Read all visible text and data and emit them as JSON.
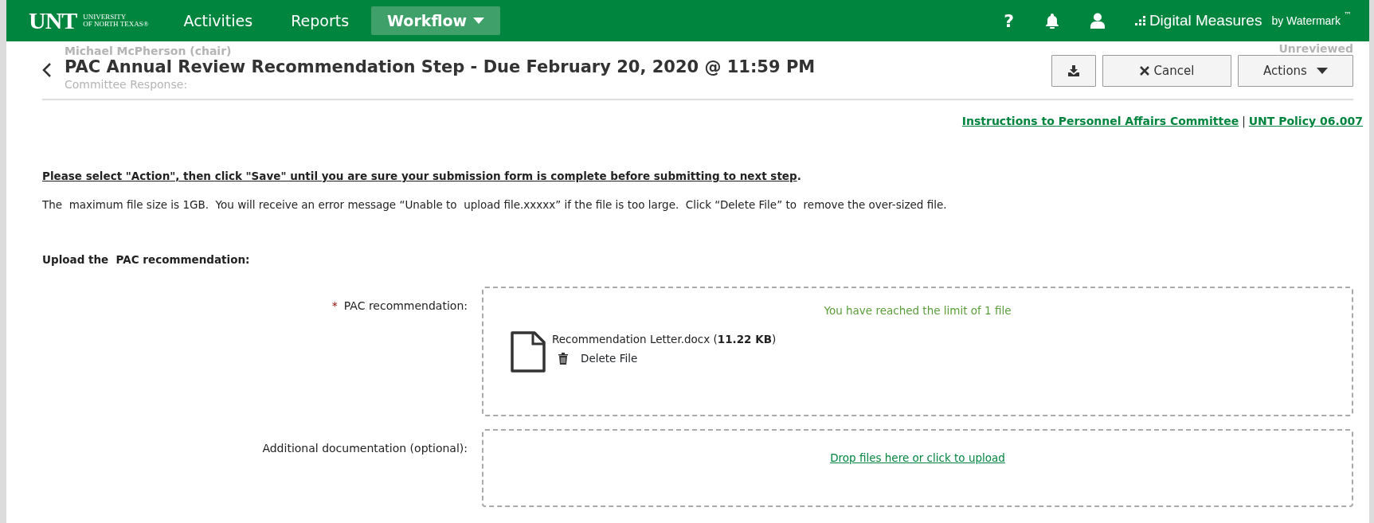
{
  "navbar": {
    "logo": {
      "wordmark": "UNT",
      "line_1": "UNIVERSITY",
      "line_2": "OF NORTH TEXAS®"
    },
    "menu": [
      {
        "label": "Activities",
        "selected": false,
        "dropdown": false
      },
      {
        "label": "Reports",
        "selected": false,
        "dropdown": false
      },
      {
        "label": "Workflow",
        "selected": true,
        "dropdown": true
      }
    ],
    "help_label": "?",
    "brand": {
      "name": "Digital Measures",
      "by": "by Watermark",
      "tm": "™"
    }
  },
  "behind_header": {
    "reviewer": "Michael McPherson (chair)",
    "response_label": "Committee Response:",
    "status": "Unreviewed"
  },
  "header": {
    "title": "PAC Annual Review Recommendation Step - Due February 20, 2020 @ 11:59 PM",
    "buttons": [
      {
        "kind": "download"
      },
      {
        "kind": "cancel",
        "label": "Cancel"
      },
      {
        "kind": "menu",
        "label": "Actions"
      }
    ]
  },
  "links": [
    {
      "label": "Instructions to Personnel Affairs Committee"
    },
    {
      "label": "UNT Policy 06.007"
    }
  ],
  "link_separator": "|",
  "notice": {
    "text": "Please select \"Action\", then click \"Save\" until you are sure your submission form is complete before submitting to next step",
    "end": "."
  },
  "info": "The  maximum file size is 1GB.  You will receive an error message “Unable to  upload file.xxxxx” if the file is too large.  Click “Delete File” to  remove the over-sized file.",
  "section_title": "Upload the  PAC recommendation:",
  "required_marker": "*",
  "fields": [
    {
      "label": "PAC recommendation:",
      "required": true,
      "kind": "files",
      "limit_message": "You have reached the limit of 1 file",
      "files": [
        {
          "name": "Recommendation Letter.docx (**11.22 KB**)",
          "delete_label": "Delete File"
        }
      ]
    },
    {
      "label": "Additional documentation (optional):",
      "required": false,
      "kind": "dropzone",
      "upload_link": "Drop files here or click to upload"
    }
  ]
}
